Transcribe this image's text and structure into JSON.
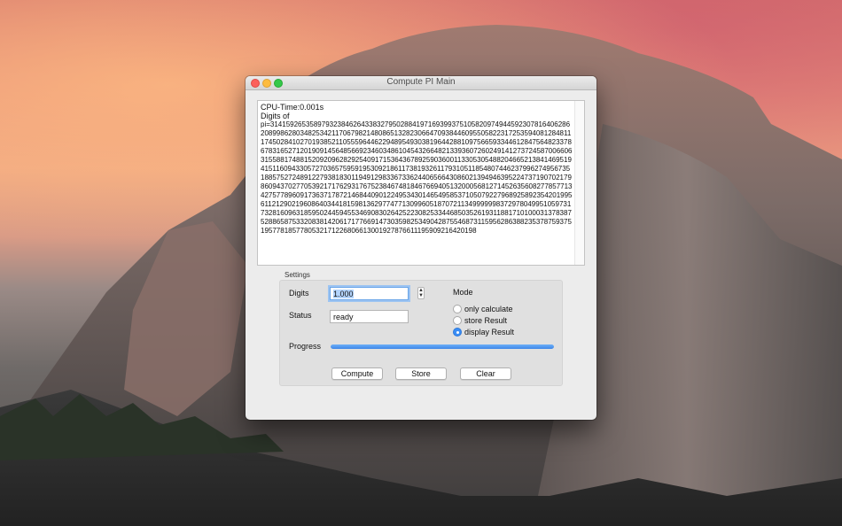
{
  "window": {
    "title": "Compute PI Main"
  },
  "output": {
    "cpu_time": "CPU-Time:0.001s",
    "digits_label": "Digits of",
    "pi_text": "pi=3141592653589793238462643383279502884197169399375105820974944592307816406286208998628034825342117067982148086513282306647093844609550582231725359408128481117450284102701938521105559644622948954930381964428810975665933446128475648233786783165271201909145648566923460348610454326648213393607260249141273724587006606315588174881520920962829254091715364367892590360011330530548820466521384146951941511609433057270365759591953092186117381932611793105118548074462379962749567351885752724891227938183011949129833673362440656643086021394946395224737190702179860943702770539217176293176752384674818467669405132000568127145263560827785771342757789609173637178721468440901224953430146549585371050792279689258923542019956112129021960864034418159813629774771309960518707211349999998372978049951059731732816096318595024459455346908302642522308253344685035261931188171010003137838752886587533208381420617177669147303598253490428755468731159562863882353787593751957781857780532171226806613001927876611195909216420198"
  },
  "settings": {
    "group_label": "Settings",
    "digits_label": "Digits",
    "digits_value": "1.000",
    "status_label": "Status",
    "status_value": "ready",
    "mode_label": "Mode",
    "mode_options": [
      {
        "label": "only calculate",
        "selected": false
      },
      {
        "label": "store Result",
        "selected": false
      },
      {
        "label": "display Result",
        "selected": true
      }
    ],
    "progress_label": "Progress",
    "progress_percent": 100
  },
  "buttons": {
    "compute": "Compute",
    "store": "Store",
    "clear": "Clear"
  },
  "colors": {
    "accent": "#3b8ef5",
    "close": "#fc605c",
    "minimize": "#fdbc40",
    "maximize": "#34c84a"
  }
}
